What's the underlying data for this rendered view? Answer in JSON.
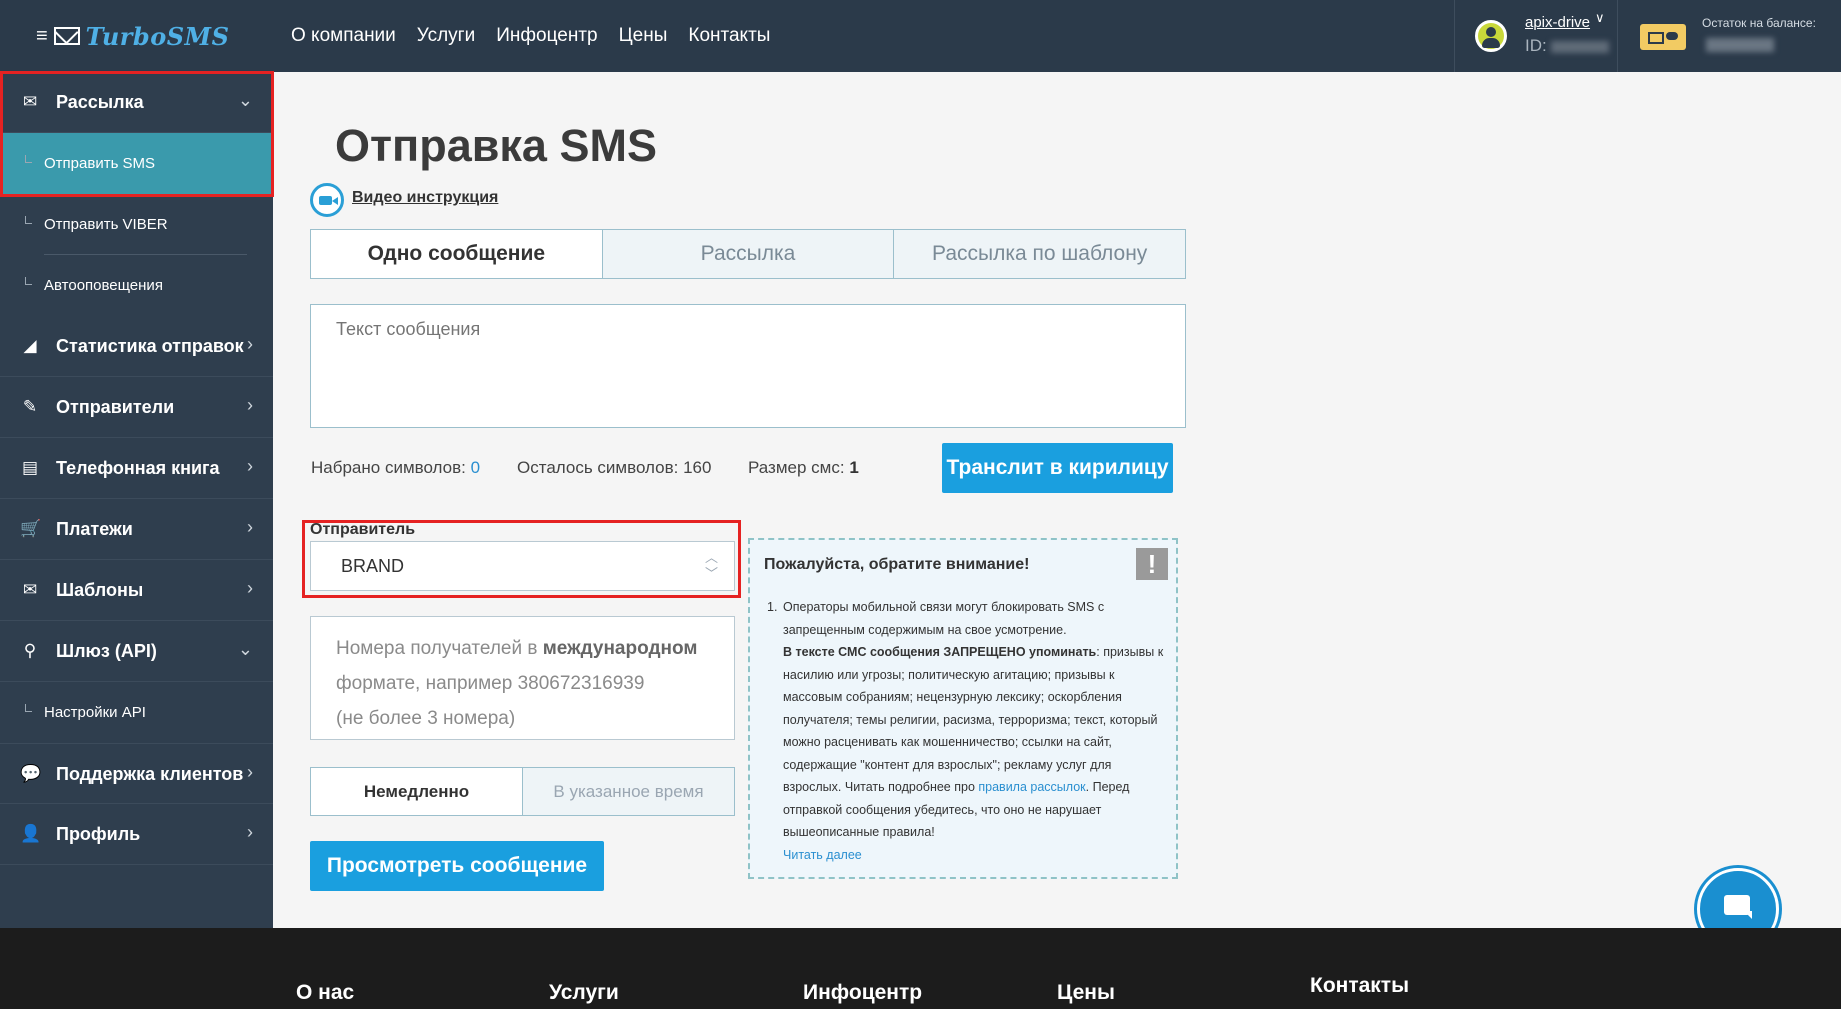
{
  "header": {
    "logo_text": "TurboSMS",
    "nav": [
      "О компании",
      "Услуги",
      "Инфоцентр",
      "Цены",
      "Контакты"
    ],
    "user": {
      "name": "apix-drive",
      "id_label": "ID:"
    },
    "balance_label": "Остаток на балансе:"
  },
  "sidebar": {
    "groups": [
      {
        "label": "Рассылка",
        "icon": "envelope-icon"
      },
      {
        "label": "Статистика отправок",
        "icon": "chart-icon"
      },
      {
        "label": "Отправители",
        "icon": "feather-icon"
      },
      {
        "label": "Телефонная книга",
        "icon": "phonebook-icon"
      },
      {
        "label": "Платежи",
        "icon": "cart-icon"
      },
      {
        "label": "Шаблоны",
        "icon": "template-envelope-icon"
      },
      {
        "label": "Шлюз (API)",
        "icon": "network-icon"
      },
      {
        "label": "Поддержка клиентов",
        "icon": "chat-icon"
      },
      {
        "label": "Профиль",
        "icon": "user-icon"
      }
    ],
    "sub_mailing": [
      "Отправить SMS",
      "Отправить VIBER",
      "Автооповещения"
    ],
    "sub_api": [
      "Настройки API"
    ]
  },
  "main": {
    "title": "Отправка SMS",
    "video_link": "Видео инструкция",
    "tabs": [
      "Одно сообщение",
      "Рассылка",
      "Рассылка по шаблону"
    ],
    "message_placeholder": "Текст сообщения",
    "stats": {
      "typed_label": "Набрано символов:",
      "typed_value": "0",
      "left_label": "Осталось символов:",
      "left_value": "160",
      "size_label": "Размер смс:",
      "size_value": "1"
    },
    "translit_button": "Транслит в кирилицу",
    "sender": {
      "label": "Отправитель",
      "value": "BRAND"
    },
    "recipients": {
      "part1": "Номера получателей в ",
      "bold": "международном",
      "part2": "формате, например 380672316939",
      "part3": "(не более 3 номера)"
    },
    "timing": [
      "Немедленно",
      "В указанное время"
    ],
    "preview_button": "Просмотреть сообщение"
  },
  "notice": {
    "title": "Пожалуйста, обратите внимание!",
    "alert_glyph": "!",
    "item_number": "1.",
    "line1": "Операторы мобильной связи могут блокировать SMS с",
    "line2": "запрещенным содержимым на свое усмотрение.",
    "bold": "В тексте СМС сообщения ЗАПРЕЩЕНО упоминать",
    "line3": ": призывы к",
    "line4": "насилию или угрозы; политическую агитацию; призывы к",
    "line5": "массовым собраниям; нецензурную лексику; оскорбления",
    "line6": "получателя; темы религии, расизма, терроризма; текст, который",
    "line7": "можно расценивать как мошенничество; ссылки на сайт,",
    "line8": "содержащие \"контент для взрослых\"; рекламу услуг для",
    "line9a": "взрослых. Читать подробнее про ",
    "link": "правила рассылок",
    "line9b": ". Перед",
    "line10": "отправкой сообщения убедитесь, что оно не нарушает",
    "line11": "вышеописанные правила!",
    "read_more": "Читать далее"
  },
  "footer": {
    "columns": [
      "О нас",
      "Услуги",
      "Инфоцентр",
      "Цены",
      "Контакты"
    ]
  },
  "colors": {
    "topbar": "#2b3a4a",
    "sidebar": "#2f3e4e",
    "active_sub": "#3a9aac",
    "primary_button": "#1a9fdf",
    "highlight_box": "#e52222"
  }
}
